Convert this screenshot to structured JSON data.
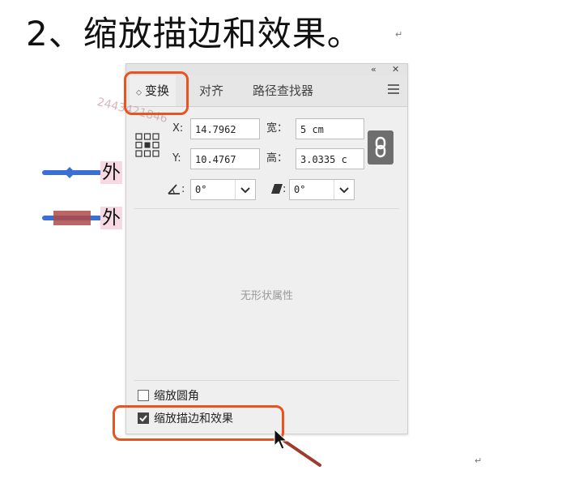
{
  "heading": "2、缩放描边和效果。",
  "artwork": {
    "label_top": "外",
    "label_bottom": "外"
  },
  "watermark": "2443421846",
  "panel": {
    "tabs": [
      {
        "label": "变换",
        "active": true
      },
      {
        "label": "对齐",
        "active": false
      },
      {
        "label": "路径查找器",
        "active": false
      }
    ],
    "title_controls": {
      "collapse": "«",
      "close": "✕"
    },
    "x_label": "X:",
    "x_value": "14.7962",
    "width_label": "宽：",
    "width_value": "5 cm",
    "y_label": "Y:",
    "y_value": "10.4767",
    "height_label": "高：",
    "height_value": "3.0335 c",
    "rotate_value": "0°",
    "shear_value": "0°",
    "empty_message": "无形状属性",
    "scale_corners_label": "缩放圆角",
    "scale_strokes_label": "缩放描边和效果"
  },
  "colors": {
    "highlight": "#e8531f",
    "blue_stroke": "#3b6fd1",
    "red_stroke": "#b04a4a"
  },
  "icons": [
    "collapse-icon",
    "close-icon",
    "menu-icon",
    "reference-point-icon",
    "link-icon",
    "rotate-icon",
    "shear-icon",
    "chevron-down-icon",
    "checkbox-icon",
    "cursor-icon"
  ]
}
